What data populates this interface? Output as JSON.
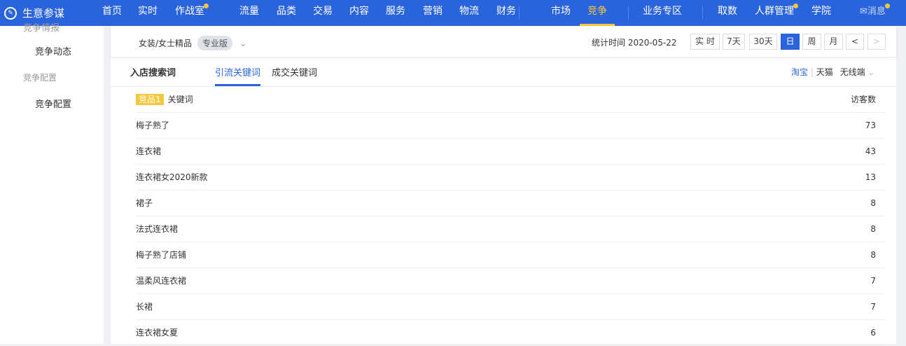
{
  "nav": {
    "brand": "生意参谋",
    "items": [
      "首页",
      "实时",
      "作战室",
      "流量",
      "品类",
      "交易",
      "内容",
      "服务",
      "营销",
      "物流",
      "财务",
      "市场",
      "竞争",
      "业务专区",
      "取数",
      "人群管理",
      "学院"
    ],
    "messages": "消息",
    "active": "竞争"
  },
  "sidebar": {
    "clipped": "竞争情报",
    "item1": "竞争动态",
    "group": "竞争配置",
    "item2": "竞争配置"
  },
  "toolbar": {
    "category": "女装/女士精品",
    "edition": "专业版",
    "stat_time": "统计时间 2020-05-22",
    "buttons": [
      "实 时",
      "7天",
      "30天",
      "日",
      "周",
      "月",
      "<",
      ">"
    ],
    "active_button": "日"
  },
  "section": {
    "title": "入店搜索词",
    "tabs": [
      "引流关键词",
      "成交关键词"
    ],
    "active_tab": "引流关键词",
    "platform_taobao": "淘宝",
    "platform_tmall": "天猫",
    "device": "无线端"
  },
  "table": {
    "badge": "竞品1",
    "col_keyword": "关键词",
    "col_visitors": "访客数",
    "rows": [
      {
        "k": "梅子熟了",
        "v": "73"
      },
      {
        "k": "连衣裙",
        "v": "43"
      },
      {
        "k": "连衣裙女2020新款",
        "v": "13"
      },
      {
        "k": "裙子",
        "v": "8"
      },
      {
        "k": "法式连衣裙",
        "v": "8"
      },
      {
        "k": "梅子熟了店铺",
        "v": "8"
      },
      {
        "k": "温柔风连衣裙",
        "v": "7"
      },
      {
        "k": "长裙",
        "v": "7"
      },
      {
        "k": "连衣裙女夏",
        "v": "6"
      }
    ]
  }
}
